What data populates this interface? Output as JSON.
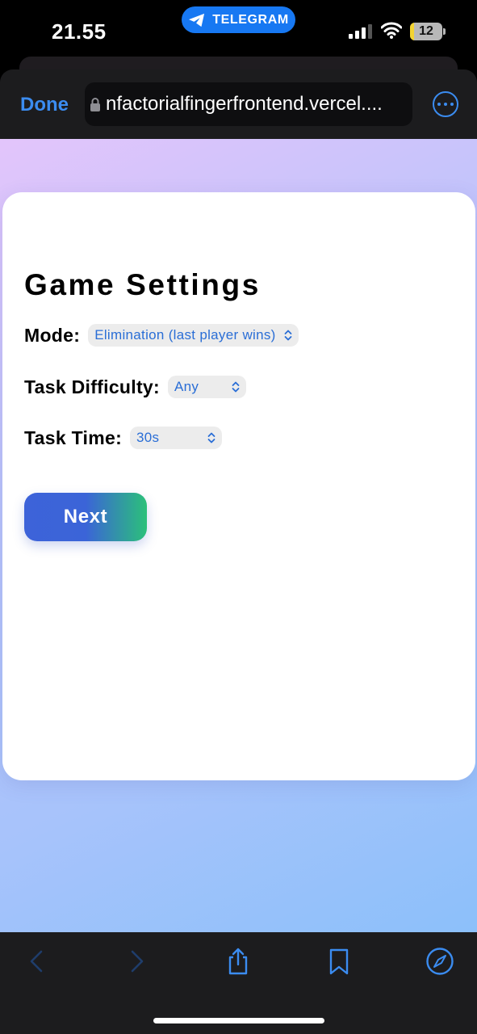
{
  "status_bar": {
    "time": "21.55",
    "return_app": "TELEGRAM",
    "battery": "12",
    "battery_level": 0.12
  },
  "browser": {
    "done_label": "Done",
    "url": "nfactorialfingerfrontend.vercel....",
    "more_icon": "ellipsis-circle-icon",
    "lock_icon": "lock-icon"
  },
  "settings": {
    "title": "Game Settings",
    "mode_label": "Mode:",
    "mode_value": "Elimination (last player wins)",
    "difficulty_label": "Task Difficulty:",
    "difficulty_value": "Any",
    "time_label": "Task Time:",
    "time_value": "30s",
    "next_label": "Next"
  },
  "toolbar": {
    "icons": [
      "back-chevron-icon",
      "forward-chevron-icon",
      "share-icon",
      "bookmarks-icon",
      "compass-icon"
    ]
  },
  "colors": {
    "accent": "#3b8cf0",
    "select_text": "#2a6ed6",
    "button_gradient_start": "#3d63d9",
    "button_gradient_end": "#2bc07a",
    "telegram_pill": "#1778f2",
    "battery_low": "#f2d331"
  }
}
